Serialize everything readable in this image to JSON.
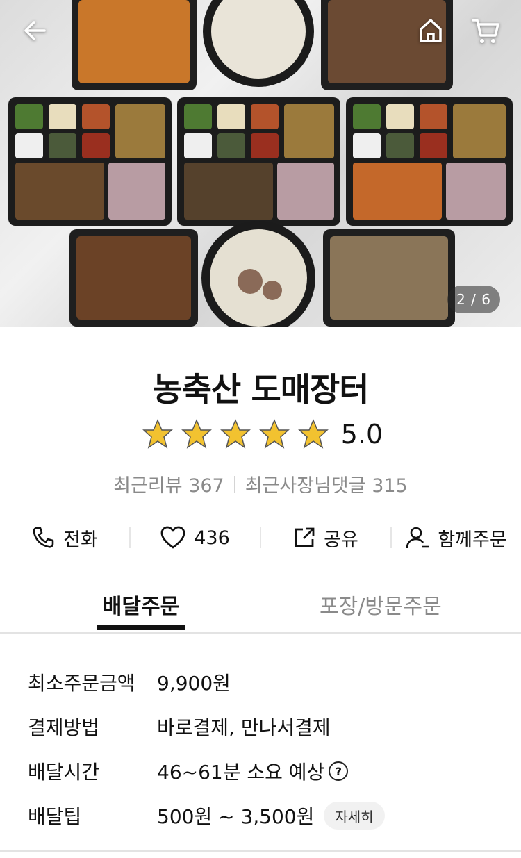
{
  "hero": {
    "counter": "2 / 6",
    "icons": [
      "back-arrow-icon",
      "home-icon",
      "cart-icon"
    ]
  },
  "store": {
    "name": "농축산 도매장터",
    "rating": "5.0",
    "stars": 5,
    "recent_reviews": "최근리뷰 367",
    "owner_replies": "최근사장님댓글 315"
  },
  "actions": {
    "call": "전화",
    "likes": "436",
    "share": "공유",
    "group_order": "함께주문"
  },
  "tabs": {
    "delivery": "배달주문",
    "pickup": "포장/방문주문"
  },
  "info": {
    "min_order_label": "최소주문금액",
    "min_order_value": "9,900원",
    "payment_label": "결제방법",
    "payment_value": "바로결제, 만나서결제",
    "time_label": "배달시간",
    "time_value": "46~61분 소요 예상",
    "tip_label": "배달팁",
    "tip_value": "500원 ~ 3,500원",
    "detail_button": "자세히"
  },
  "colors": {
    "star": "#F2C230",
    "text": "#111111",
    "muted": "#8A8A8A"
  }
}
